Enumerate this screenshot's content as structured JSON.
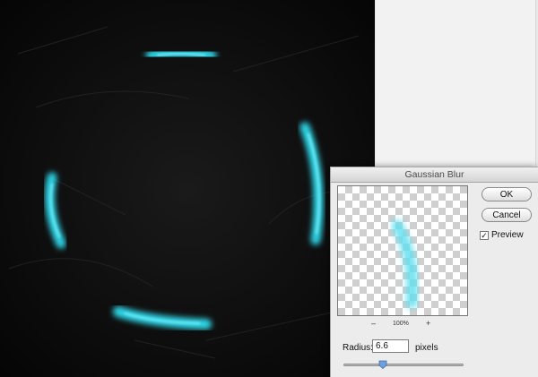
{
  "dialog": {
    "title": "Gaussian Blur",
    "ok_label": "OK",
    "cancel_label": "Cancel",
    "preview_label": "Preview",
    "preview_checked": true,
    "preview_check_glyph": "✓",
    "zoom_out_label": "–",
    "zoom_level": "100%",
    "zoom_in_label": "+",
    "radius_label": "Radius:",
    "radius_value": "6.6",
    "radius_unit": "pixels",
    "radius_slider_fraction": 0.33
  },
  "colors": {
    "glow": "#2fd6e8",
    "canvas_background": "#0a0a0a",
    "slider_thumb": "#6fa0d8"
  },
  "icons": {
    "slider_thumb": "slider-thumb-icon",
    "checkbox": "checkmark-icon"
  }
}
